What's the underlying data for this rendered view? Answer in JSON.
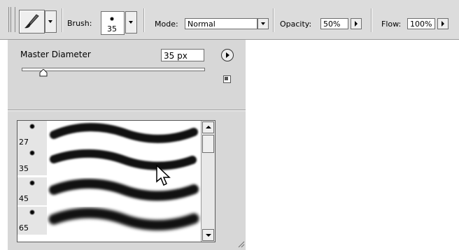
{
  "options_bar": {
    "tool_icon": "paintbrush-icon",
    "brush_label": "Brush:",
    "brush_size": "35",
    "mode_label": "Mode:",
    "mode_value": "Normal",
    "opacity_label": "Opacity:",
    "opacity_value": "50%",
    "flow_label": "Flow:",
    "flow_value": "100%"
  },
  "brush_panel": {
    "master_diameter_label": "Master Diameter",
    "master_diameter_value": "35 px",
    "slider_fraction": 0.12,
    "brushes": [
      {
        "size": "27",
        "selected": false
      },
      {
        "size": "35",
        "selected": true
      },
      {
        "size": "45",
        "selected": false
      },
      {
        "size": "65",
        "selected": false
      }
    ]
  },
  "colors": {
    "chrome": "#dcdcdc",
    "panel": "#d7d7d7",
    "stroke": "#000000"
  }
}
